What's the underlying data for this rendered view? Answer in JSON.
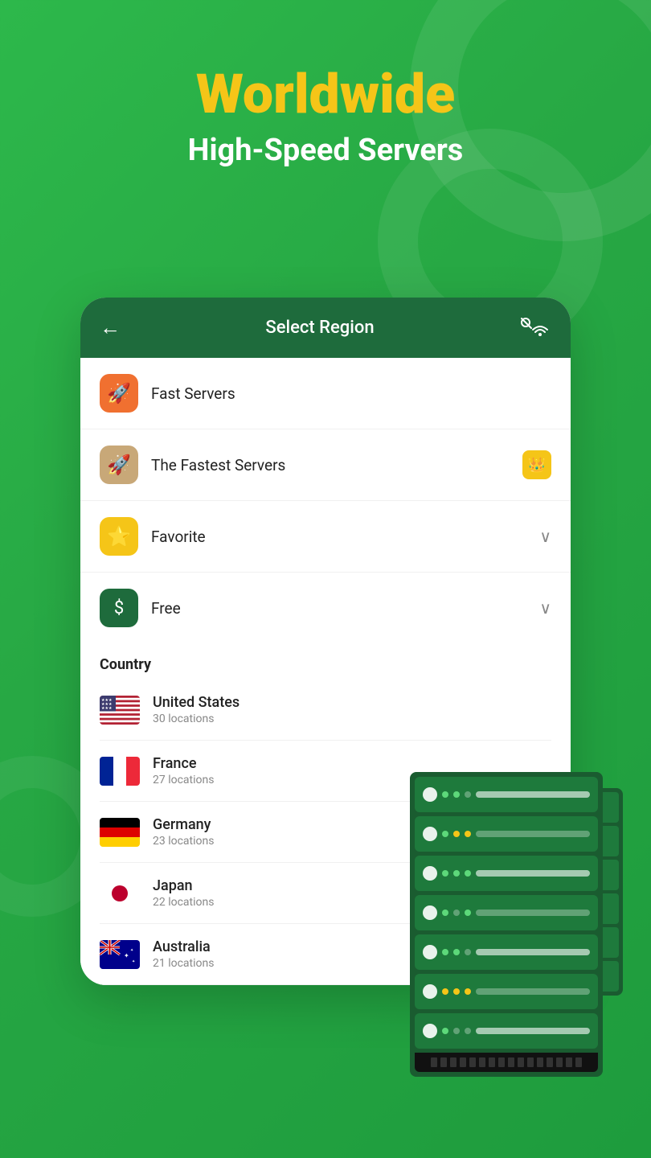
{
  "background": {
    "color": "#2db84b"
  },
  "header": {
    "main_title": "Worldwide",
    "sub_title": "High-Speed Servers"
  },
  "card": {
    "header": {
      "back_label": "←",
      "title": "Select Region",
      "wifi_icon": "wifi-search"
    },
    "menu_items": [
      {
        "id": "fast-servers",
        "label": "Fast Servers",
        "icon_type": "rocket",
        "icon_bg": "orange",
        "right": "none"
      },
      {
        "id": "fastest-servers",
        "label": "The Fastest Servers",
        "icon_type": "rocket-tan",
        "icon_bg": "tan",
        "right": "crown"
      },
      {
        "id": "favorite",
        "label": "Favorite",
        "icon_type": "star",
        "icon_bg": "yellow",
        "right": "chevron"
      },
      {
        "id": "free",
        "label": "Free",
        "icon_type": "dollar-circle",
        "icon_bg": "green-dark",
        "right": "chevron"
      }
    ],
    "country_section": {
      "label": "Country",
      "countries": [
        {
          "id": "us",
          "name": "United States",
          "locations": "30 locations",
          "flag": "us"
        },
        {
          "id": "fr",
          "name": "France",
          "locations": "27 locations",
          "flag": "france"
        },
        {
          "id": "de",
          "name": "Germany",
          "locations": "23 locations",
          "flag": "germany"
        },
        {
          "id": "jp",
          "name": "Japan",
          "locations": "22 locations",
          "flag": "japan"
        },
        {
          "id": "au",
          "name": "Australia",
          "locations": "21 locations",
          "flag": "australia"
        }
      ]
    }
  }
}
